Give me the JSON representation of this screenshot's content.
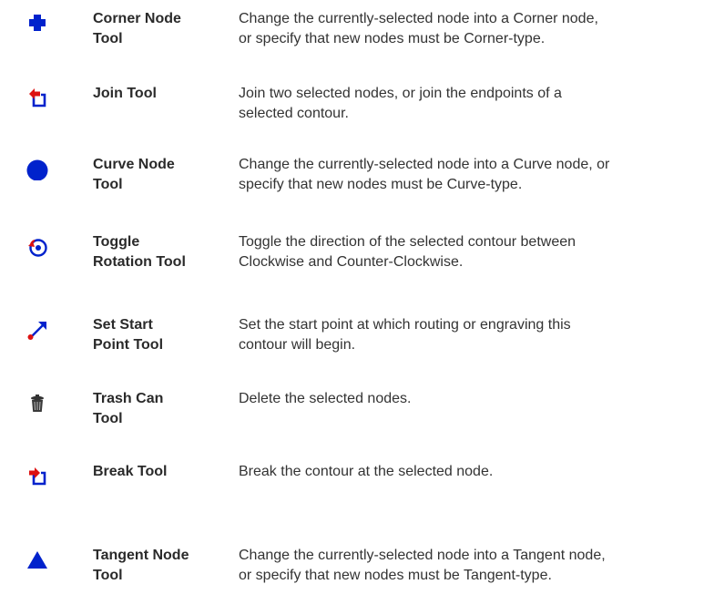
{
  "tools": [
    {
      "name_line1": "Corner Node",
      "name_line2": "Tool",
      "desc_line1": "Change the currently-selected node into a Corner node,",
      "desc_line2": "or specify that new nodes must be Corner-type.",
      "icon": "corner-node-cross-icon"
    },
    {
      "name_line1": "Join Tool",
      "name_line2": "",
      "desc_line1": "Join two selected nodes, or join the endpoints of a",
      "desc_line2": "selected contour.",
      "icon": "join-icon"
    },
    {
      "name_line1": "Curve Node",
      "name_line2": "Tool",
      "desc_line1": "Change the currently-selected node into a Curve node, or",
      "desc_line2": "specify that new nodes must be Curve-type.",
      "icon": "curve-node-circle-icon"
    },
    {
      "name_line1": "Toggle",
      "name_line2": "Rotation Tool",
      "desc_line1": "Toggle the direction of the selected contour between",
      "desc_line2": "Clockwise and Counter-Clockwise.",
      "icon": "toggle-rotation-icon"
    },
    {
      "name_line1": "Set Start",
      "name_line2": "Point Tool",
      "desc_line1": "Set the start point at which routing or engraving this",
      "desc_line2": "contour will begin.",
      "icon": "start-point-arrow-icon"
    },
    {
      "name_line1": "Trash Can",
      "name_line2": "Tool",
      "desc_line1": "Delete the selected nodes.",
      "desc_line2": "",
      "icon": "trash-can-icon"
    },
    {
      "name_line1": "Break Tool",
      "name_line2": "",
      "desc_line1": "Break the contour at the selected node.",
      "desc_line2": "",
      "icon": "break-icon"
    },
    {
      "name_line1": "Tangent Node",
      "name_line2": "Tool",
      "desc_line1": "Change the currently-selected node into a Tangent node,",
      "desc_line2": "or specify that new nodes must be Tangent-type.",
      "icon": "tangent-node-triangle-icon"
    }
  ],
  "colors": {
    "icon_blue": "#0022cc",
    "icon_red": "#dd1111"
  }
}
